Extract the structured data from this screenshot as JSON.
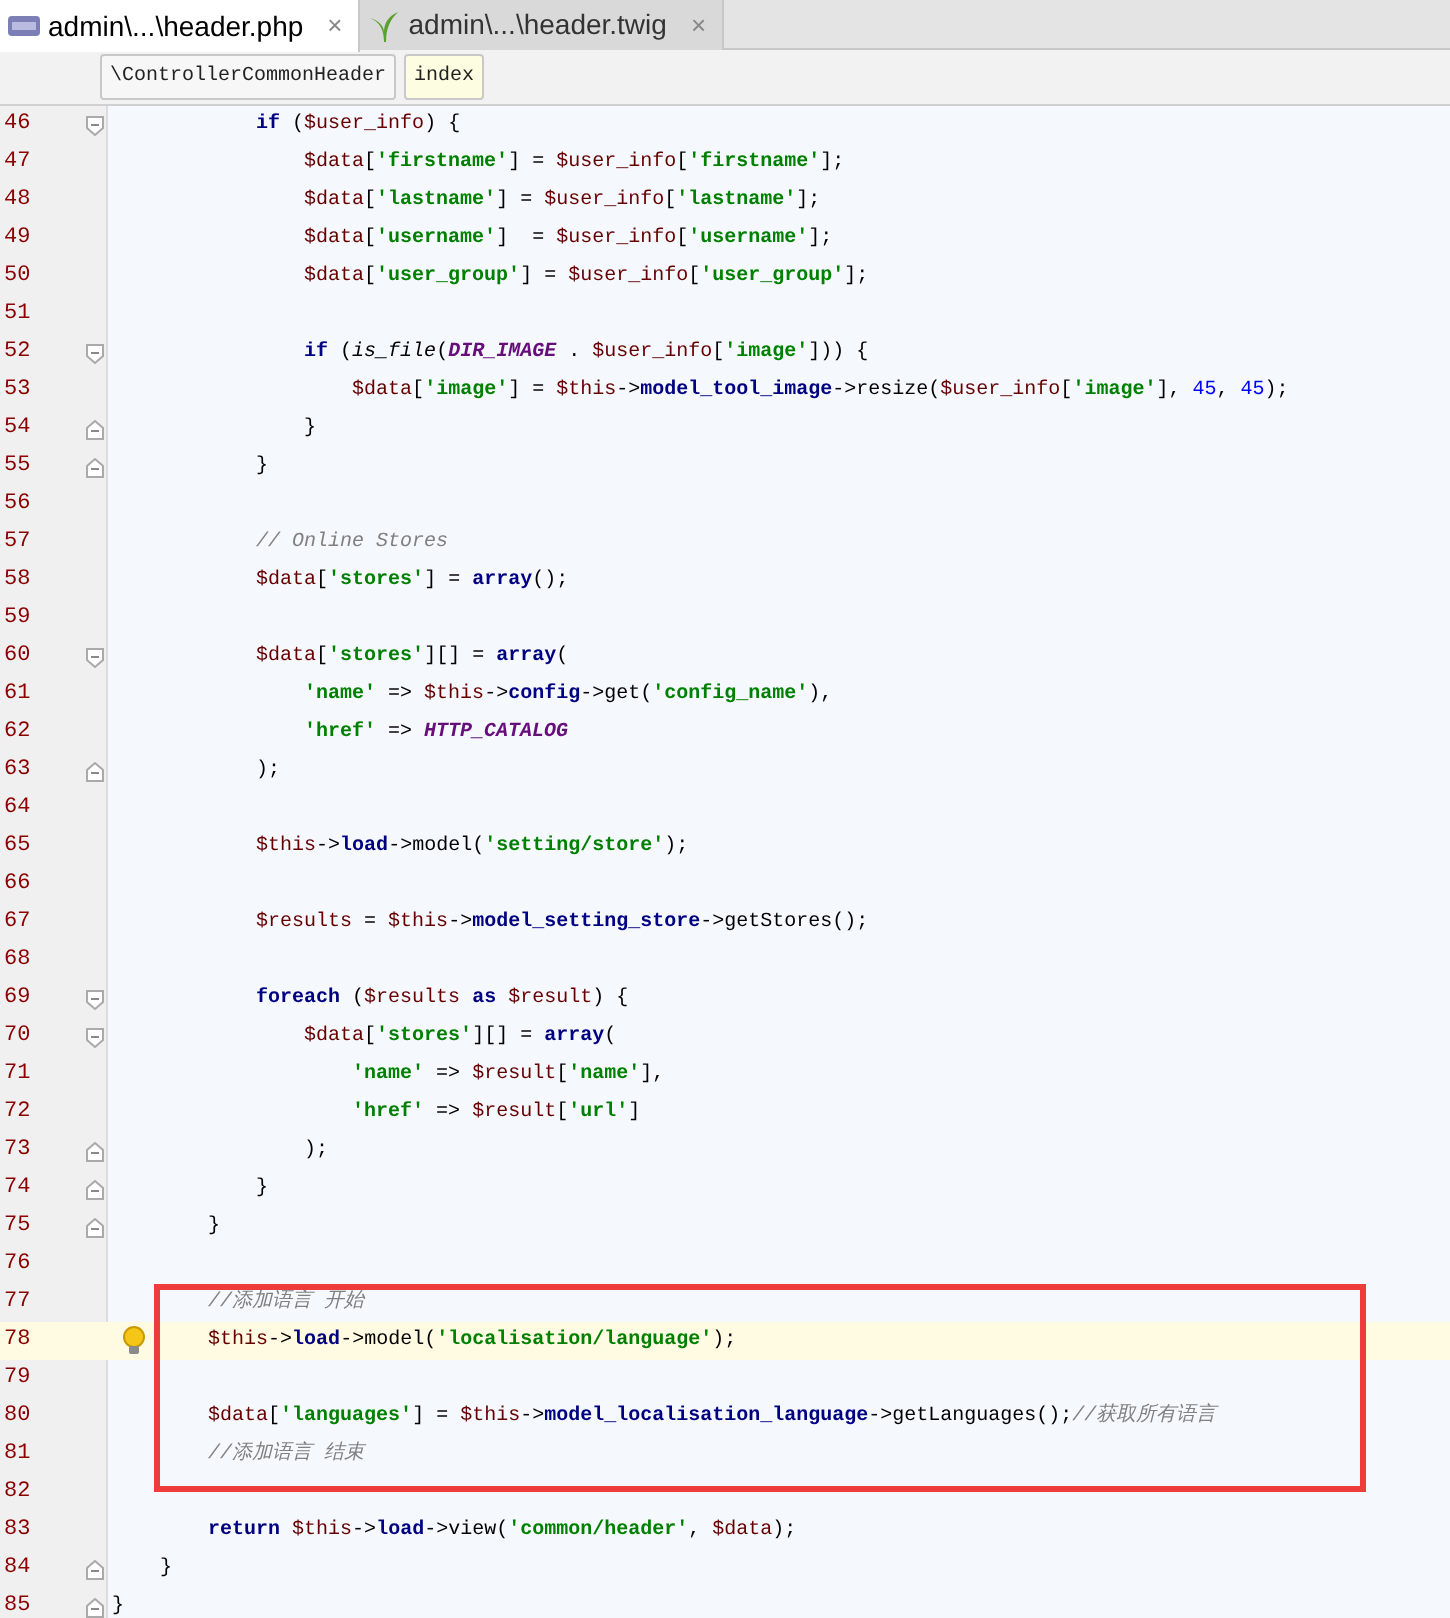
{
  "tabs": [
    {
      "label": "admin\\...\\header.php",
      "kind": "php",
      "selected": true,
      "close": "×"
    },
    {
      "label": "admin\\...\\header.twig",
      "kind": "twig",
      "selected": false,
      "close": "×"
    }
  ],
  "breadcrumbs": [
    {
      "label": "\\ControllerCommonHeader",
      "selected": false
    },
    {
      "label": "index",
      "selected": true
    }
  ],
  "lines": [
    {
      "number": "46",
      "fold_open": true,
      "tokens": [
        {
          "kind": "kw",
          "text": "            if"
        },
        {
          "kind": "p",
          "text": " ("
        },
        {
          "kind": "var",
          "text": "$user_info"
        },
        {
          "kind": "p",
          "text": ") {"
        }
      ]
    },
    {
      "number": "47",
      "tokens": [
        {
          "kind": "var",
          "text": "                $data"
        },
        {
          "kind": "p",
          "text": "["
        },
        {
          "kind": "str",
          "text": "'firstname'"
        },
        {
          "kind": "p",
          "text": "] = "
        },
        {
          "kind": "var",
          "text": "$user_info"
        },
        {
          "kind": "p",
          "text": "["
        },
        {
          "kind": "str",
          "text": "'firstname'"
        },
        {
          "kind": "p",
          "text": "];"
        }
      ]
    },
    {
      "number": "48",
      "tokens": [
        {
          "kind": "var",
          "text": "                $data"
        },
        {
          "kind": "p",
          "text": "["
        },
        {
          "kind": "str",
          "text": "'lastname'"
        },
        {
          "kind": "p",
          "text": "] = "
        },
        {
          "kind": "var",
          "text": "$user_info"
        },
        {
          "kind": "p",
          "text": "["
        },
        {
          "kind": "str",
          "text": "'lastname'"
        },
        {
          "kind": "p",
          "text": "];"
        }
      ]
    },
    {
      "number": "49",
      "tokens": [
        {
          "kind": "var",
          "text": "                $data"
        },
        {
          "kind": "p",
          "text": "["
        },
        {
          "kind": "str",
          "text": "'username'"
        },
        {
          "kind": "p",
          "text": "]  = "
        },
        {
          "kind": "var",
          "text": "$user_info"
        },
        {
          "kind": "p",
          "text": "["
        },
        {
          "kind": "str",
          "text": "'username'"
        },
        {
          "kind": "p",
          "text": "];"
        }
      ]
    },
    {
      "number": "50",
      "tokens": [
        {
          "kind": "var",
          "text": "                $data"
        },
        {
          "kind": "p",
          "text": "["
        },
        {
          "kind": "str",
          "text": "'user_group'"
        },
        {
          "kind": "p",
          "text": "] = "
        },
        {
          "kind": "var",
          "text": "$user_info"
        },
        {
          "kind": "p",
          "text": "["
        },
        {
          "kind": "str",
          "text": "'user_group'"
        },
        {
          "kind": "p",
          "text": "];"
        }
      ]
    },
    {
      "number": "51"
    },
    {
      "number": "52",
      "fold_open": true,
      "tokens": [
        {
          "kind": "kw",
          "text": "                if"
        },
        {
          "kind": "p",
          "text": " ("
        },
        {
          "kind": "fn",
          "text": "is_file"
        },
        {
          "kind": "p",
          "text": "("
        },
        {
          "kind": "const",
          "text": "DIR_IMAGE"
        },
        {
          "kind": "p",
          "text": " . "
        },
        {
          "kind": "var",
          "text": "$user_info"
        },
        {
          "kind": "p",
          "text": "["
        },
        {
          "kind": "str",
          "text": "'image'"
        },
        {
          "kind": "p",
          "text": "])) {"
        }
      ]
    },
    {
      "number": "53",
      "tokens": [
        {
          "kind": "var",
          "text": "                    $data"
        },
        {
          "kind": "p",
          "text": "["
        },
        {
          "kind": "str",
          "text": "'image'"
        },
        {
          "kind": "p",
          "text": "] = "
        },
        {
          "kind": "var",
          "text": "$this"
        },
        {
          "kind": "p",
          "text": "->"
        },
        {
          "kind": "field",
          "text": "model_tool_image"
        },
        {
          "kind": "p",
          "text": "->resize("
        },
        {
          "kind": "var",
          "text": "$user_info"
        },
        {
          "kind": "p",
          "text": "["
        },
        {
          "kind": "str",
          "text": "'image'"
        },
        {
          "kind": "p",
          "text": "], "
        },
        {
          "kind": "num",
          "text": "45"
        },
        {
          "kind": "p",
          "text": ", "
        },
        {
          "kind": "num",
          "text": "45"
        },
        {
          "kind": "p",
          "text": ");"
        }
      ]
    },
    {
      "number": "54",
      "fold_close": true,
      "tokens": [
        {
          "kind": "p",
          "text": "                }"
        }
      ]
    },
    {
      "number": "55",
      "fold_close": true,
      "tokens": [
        {
          "kind": "p",
          "text": "            }"
        }
      ]
    },
    {
      "number": "56"
    },
    {
      "number": "57",
      "tokens": [
        {
          "kind": "cmt",
          "text": "            // Online Stores"
        }
      ]
    },
    {
      "number": "58",
      "tokens": [
        {
          "kind": "var",
          "text": "            $data"
        },
        {
          "kind": "p",
          "text": "["
        },
        {
          "kind": "str",
          "text": "'stores'"
        },
        {
          "kind": "p",
          "text": "] = "
        },
        {
          "kind": "kw",
          "text": "array"
        },
        {
          "kind": "p",
          "text": "();"
        }
      ]
    },
    {
      "number": "59"
    },
    {
      "number": "60",
      "fold_open": true,
      "tokens": [
        {
          "kind": "var",
          "text": "            $data"
        },
        {
          "kind": "p",
          "text": "["
        },
        {
          "kind": "str",
          "text": "'stores'"
        },
        {
          "kind": "p",
          "text": "][] = "
        },
        {
          "kind": "kw",
          "text": "array"
        },
        {
          "kind": "p",
          "text": "("
        }
      ]
    },
    {
      "number": "61",
      "tokens": [
        {
          "kind": "str",
          "text": "                'name'"
        },
        {
          "kind": "p",
          "text": " => "
        },
        {
          "kind": "var",
          "text": "$this"
        },
        {
          "kind": "p",
          "text": "->"
        },
        {
          "kind": "field",
          "text": "config"
        },
        {
          "kind": "p",
          "text": "->get("
        },
        {
          "kind": "str",
          "text": "'config_name'"
        },
        {
          "kind": "p",
          "text": "),"
        }
      ]
    },
    {
      "number": "62",
      "tokens": [
        {
          "kind": "str",
          "text": "                'href'"
        },
        {
          "kind": "p",
          "text": " => "
        },
        {
          "kind": "const",
          "text": "HTTP_CATALOG"
        }
      ]
    },
    {
      "number": "63",
      "fold_close": true,
      "tokens": [
        {
          "kind": "p",
          "text": "            );"
        }
      ]
    },
    {
      "number": "64"
    },
    {
      "number": "65",
      "tokens": [
        {
          "kind": "var",
          "text": "            $this"
        },
        {
          "kind": "p",
          "text": "->"
        },
        {
          "kind": "field",
          "text": "load"
        },
        {
          "kind": "p",
          "text": "->model("
        },
        {
          "kind": "str",
          "text": "'setting/store'"
        },
        {
          "kind": "p",
          "text": ");"
        }
      ]
    },
    {
      "number": "66"
    },
    {
      "number": "67",
      "tokens": [
        {
          "kind": "var",
          "text": "            $results"
        },
        {
          "kind": "p",
          "text": " = "
        },
        {
          "kind": "var",
          "text": "$this"
        },
        {
          "kind": "p",
          "text": "->"
        },
        {
          "kind": "field",
          "text": "model_setting_store"
        },
        {
          "kind": "p",
          "text": "->getStores();"
        }
      ]
    },
    {
      "number": "68"
    },
    {
      "number": "69",
      "fold_open": true,
      "tokens": [
        {
          "kind": "kw",
          "text": "            foreach"
        },
        {
          "kind": "p",
          "text": " ("
        },
        {
          "kind": "var",
          "text": "$results"
        },
        {
          "kind": "kw",
          "text": " as "
        },
        {
          "kind": "var",
          "text": "$result"
        },
        {
          "kind": "p",
          "text": ") {"
        }
      ]
    },
    {
      "number": "70",
      "fold_open": true,
      "tokens": [
        {
          "kind": "var",
          "text": "                $data"
        },
        {
          "kind": "p",
          "text": "["
        },
        {
          "kind": "str",
          "text": "'stores'"
        },
        {
          "kind": "p",
          "text": "][] = "
        },
        {
          "kind": "kw",
          "text": "array"
        },
        {
          "kind": "p",
          "text": "("
        }
      ]
    },
    {
      "number": "71",
      "tokens": [
        {
          "kind": "str",
          "text": "                    'name'"
        },
        {
          "kind": "p",
          "text": " => "
        },
        {
          "kind": "var",
          "text": "$result"
        },
        {
          "kind": "p",
          "text": "["
        },
        {
          "kind": "str",
          "text": "'name'"
        },
        {
          "kind": "p",
          "text": "],"
        }
      ]
    },
    {
      "number": "72",
      "tokens": [
        {
          "kind": "str",
          "text": "                    'href'"
        },
        {
          "kind": "p",
          "text": " => "
        },
        {
          "kind": "var",
          "text": "$result"
        },
        {
          "kind": "p",
          "text": "["
        },
        {
          "kind": "str",
          "text": "'url'"
        },
        {
          "kind": "p",
          "text": "]"
        }
      ]
    },
    {
      "number": "73",
      "fold_close": true,
      "tokens": [
        {
          "kind": "p",
          "text": "                );"
        }
      ]
    },
    {
      "number": "74",
      "fold_close": true,
      "tokens": [
        {
          "kind": "p",
          "text": "            }"
        }
      ]
    },
    {
      "number": "75",
      "fold_close": true,
      "tokens": [
        {
          "kind": "p",
          "text": "        }"
        }
      ]
    },
    {
      "number": "76"
    }
  ],
  "annotation_frame": {
    "lines": [
      {
        "number": "77",
        "tokens": [
          {
            "kind": "cmt",
            "text": "        //添加语言 开始"
          }
        ]
      },
      {
        "number": "78",
        "current": true,
        "bulb": true,
        "tokens": [
          {
            "kind": "var",
            "text": "        $this"
          },
          {
            "kind": "p",
            "text": "->"
          },
          {
            "kind": "field",
            "text": "load"
          },
          {
            "kind": "p",
            "text": "->model("
          },
          {
            "kind": "str",
            "text": "'localisation/language'"
          },
          {
            "kind": "p",
            "text": ");"
          }
        ]
      },
      {
        "number": "79"
      },
      {
        "number": "80",
        "tokens": [
          {
            "kind": "var",
            "text": "        $data"
          },
          {
            "kind": "p",
            "text": "["
          },
          {
            "kind": "str",
            "text": "'languages'"
          },
          {
            "kind": "p",
            "text": "] = "
          },
          {
            "kind": "var",
            "text": "$this"
          },
          {
            "kind": "p",
            "text": "->"
          },
          {
            "kind": "field",
            "text": "model_localisation_language"
          },
          {
            "kind": "p",
            "text": "->getLanguages();"
          },
          {
            "kind": "cmt",
            "text": "//获取所有语言"
          }
        ]
      },
      {
        "number": "81",
        "tokens": [
          {
            "kind": "cmt",
            "text": "        //添加语言 结束"
          }
        ]
      },
      {
        "number": "82"
      }
    ]
  },
  "lines_after": [
    {
      "number": "83",
      "tokens": [
        {
          "kind": "kw",
          "text": "        return "
        },
        {
          "kind": "var",
          "text": "$this"
        },
        {
          "kind": "p",
          "text": "->"
        },
        {
          "kind": "field",
          "text": "load"
        },
        {
          "kind": "p",
          "text": "->view("
        },
        {
          "kind": "str",
          "text": "'common/header'"
        },
        {
          "kind": "p",
          "text": ", "
        },
        {
          "kind": "var",
          "text": "$data"
        },
        {
          "kind": "p",
          "text": ");"
        }
      ]
    },
    {
      "number": "84",
      "fold_close": true,
      "tokens": [
        {
          "kind": "p",
          "text": "    }"
        }
      ]
    },
    {
      "number": "85",
      "fold_close": true,
      "tokens": [
        {
          "kind": "p",
          "text": "}"
        }
      ]
    }
  ]
}
